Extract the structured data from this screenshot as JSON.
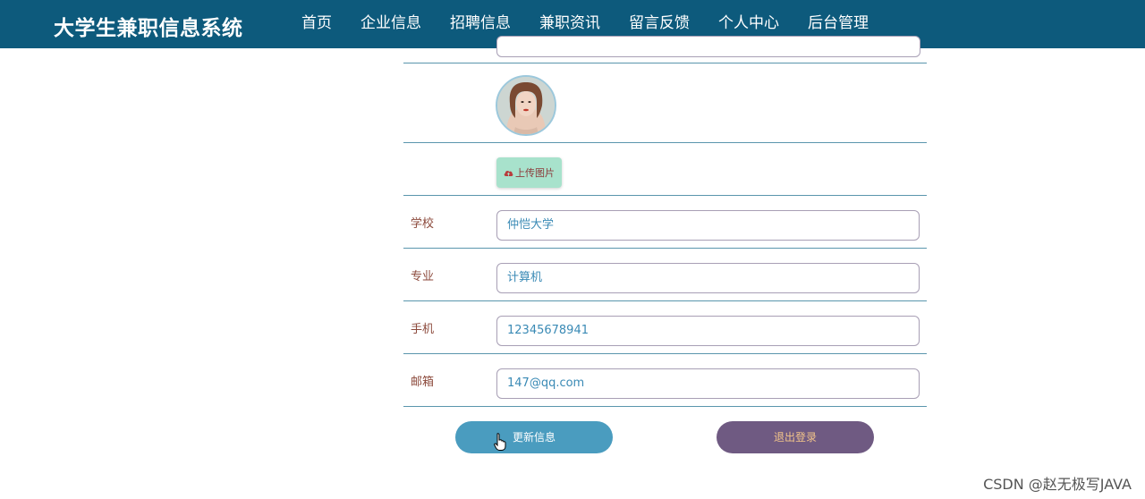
{
  "brand": "大学生兼职信息系统",
  "nav": [
    {
      "label": "首页",
      "active": false
    },
    {
      "label": "企业信息",
      "active": false
    },
    {
      "label": "招聘信息",
      "active": false
    },
    {
      "label": "兼职资讯",
      "active": false
    },
    {
      "label": "留言反馈",
      "active": false
    },
    {
      "label": "个人中心",
      "active": true
    },
    {
      "label": "后台管理",
      "active": false
    }
  ],
  "upload_label": "上传图片",
  "fields": [
    {
      "label": "学校",
      "value": "仲恺大学"
    },
    {
      "label": "专业",
      "value": "计算机"
    },
    {
      "label": "手机",
      "value": "12345678941"
    },
    {
      "label": "邮箱",
      "value": "147@qq.com"
    }
  ],
  "buttons": {
    "update": "更新信息",
    "logout": "退出登录"
  },
  "watermark": "CSDN @赵无极写JAVA",
  "colors": {
    "navbar": "#0d5a7c",
    "update_button": "#4a9cbf",
    "logout_button": "#6f5a82",
    "upload_button": "#a8e2cc"
  }
}
